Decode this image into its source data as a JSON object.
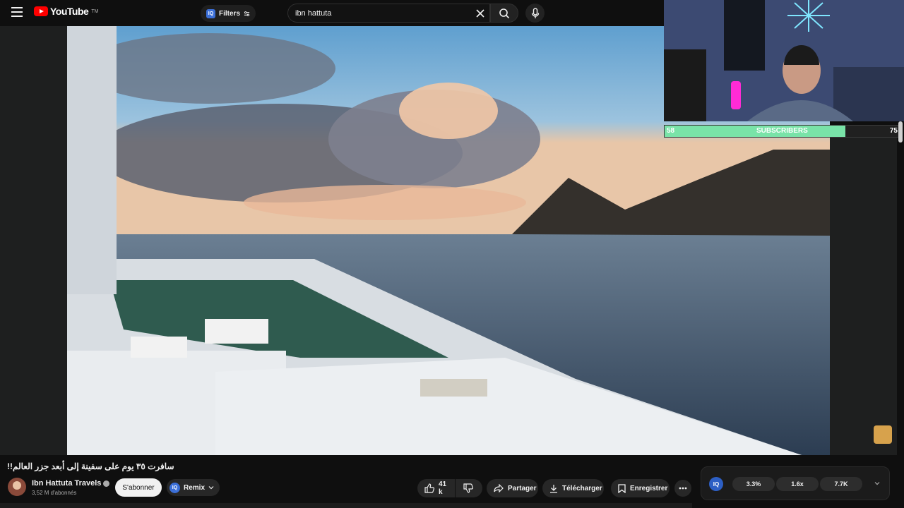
{
  "header": {
    "logo_text": "YouTube",
    "logo_sup": "TM",
    "filters_label": "Filters",
    "filters_badge": "IQ",
    "search_value": "ibn hattuta"
  },
  "overlay": {
    "subs_current": "58",
    "subs_label": "SUBSCRIBERS",
    "subs_goal": "75",
    "subs_progress": 0.77
  },
  "video": {
    "title": "سافرت ٣٥ يوم على سفينة إلى أبعد جزر العالم!!"
  },
  "channel": {
    "name": "Ibn Hattuta Travels",
    "subscribers": "3,52 M d'abonnés",
    "subscribe_label": "S'abonner",
    "remix_label": "Remix",
    "remix_badge": "IQ"
  },
  "actions": {
    "likes": "41 k",
    "share": "Partager",
    "download": "Télécharger",
    "save": "Enregistrer"
  },
  "stats": {
    "badge": "IQ",
    "items": [
      "3.3%",
      "1.6x",
      "7.7K"
    ]
  },
  "colors": {
    "accent_red": "#ff0000",
    "progress_green": "#79e3a8",
    "iq_blue": "#3b6fd8"
  }
}
